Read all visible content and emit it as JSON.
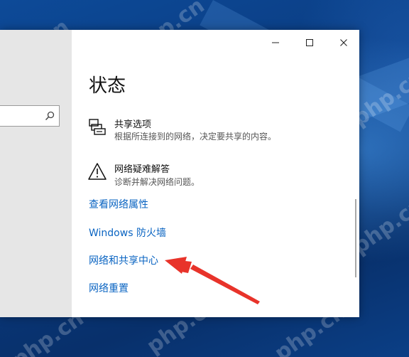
{
  "window": {
    "title": "状态",
    "controls": {
      "minimize_icon": "minimize-icon",
      "maximize_icon": "maximize-icon",
      "close_icon": "close-icon"
    }
  },
  "sidebar": {
    "search": {
      "placeholder": "",
      "icon": "search-icon"
    }
  },
  "items": [
    {
      "icon": "sharing-options-icon",
      "title": "共享选项",
      "description": "根据所连接到的网络，决定要共享的内容。"
    },
    {
      "icon": "warning-triangle-icon",
      "title": "网络疑难解答",
      "description": "诊断并解决网络问题。"
    }
  ],
  "links": [
    {
      "label": "查看网络属性"
    },
    {
      "label": "Windows 防火墙"
    },
    {
      "label": "网络和共享中心"
    },
    {
      "label": "网络重置"
    }
  ],
  "watermark": "php.cn",
  "colors": {
    "link": "#0a64c2",
    "annotation_arrow": "#e8332a",
    "desktop": "#0a3f86",
    "sidebar": "#e6e6e6"
  }
}
